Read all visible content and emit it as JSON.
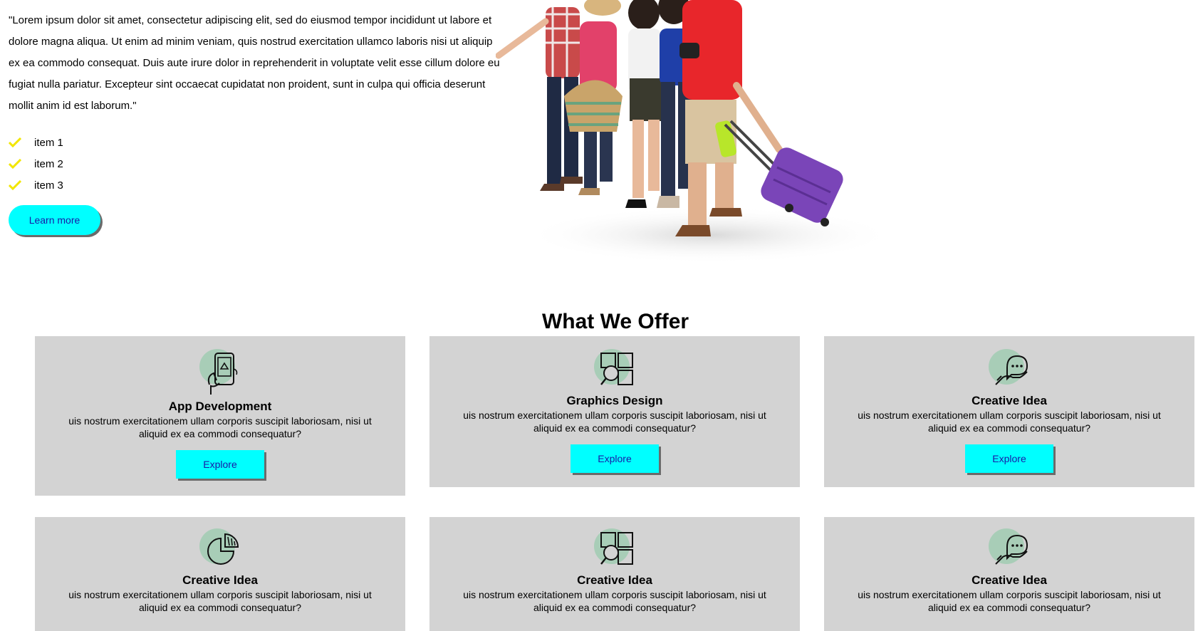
{
  "intro": {
    "quote": "\"Lorem ipsum dolor sit amet, consectetur adipiscing elit, sed do eiusmod tempor incididunt ut labore et dolore magna aliqua. Ut enim ad minim veniam, quis nostrud exercitation ullamco laboris nisi ut aliquip ex ea commodo consequat. Duis aute irure dolor in reprehenderit in voluptate velit esse cillum dolore eu fugiat nulla pariatur. Excepteur sint occaecat cupidatat non proident, sunt in culpa qui officia deserunt mollit anim id est laborum.\"",
    "items": [
      "item 1",
      "item 2",
      "item 3"
    ],
    "learn_more": "Learn more"
  },
  "colors": {
    "accent": "#00ffff",
    "check": "#f2e600",
    "card_bg": "#d3d3d3",
    "icon_blob": "#a8cdb7",
    "button_text": "#1a1aa6"
  },
  "offer": {
    "title": "What We Offer",
    "cards": [
      {
        "icon": "mobile-app-icon",
        "title": "App Development",
        "text": "uis nostrum exercitationem ullam corporis suscipit laboriosam, nisi ut aliquid ex ea commodi consequatur?",
        "button": "Explore"
      },
      {
        "icon": "design-search-icon",
        "title": "Graphics Design",
        "text": "uis nostrum exercitationem ullam corporis suscipit laboriosam, nisi ut aliquid ex ea commodi consequatur?",
        "button": "Explore"
      },
      {
        "icon": "chat-hand-icon",
        "title": "Creative Idea",
        "text": "uis nostrum exercitationem ullam corporis suscipit laboriosam, nisi ut aliquid ex ea commodi consequatur?",
        "button": "Explore"
      },
      {
        "icon": "pie-chart-icon",
        "title": "Creative Idea",
        "text": "uis nostrum exercitationem ullam corporis suscipit laboriosam, nisi ut aliquid ex ea commodi consequatur?"
      },
      {
        "icon": "design-search-icon",
        "title": "Creative Idea",
        "text": "uis nostrum exercitationem ullam corporis suscipit laboriosam, nisi ut aliquid ex ea commodi consequatur?"
      },
      {
        "icon": "chat-hand-icon",
        "title": "Creative Idea",
        "text": "uis nostrum exercitationem ullam corporis suscipit laboriosam, nisi ut aliquid ex ea commodi consequatur?"
      }
    ]
  }
}
